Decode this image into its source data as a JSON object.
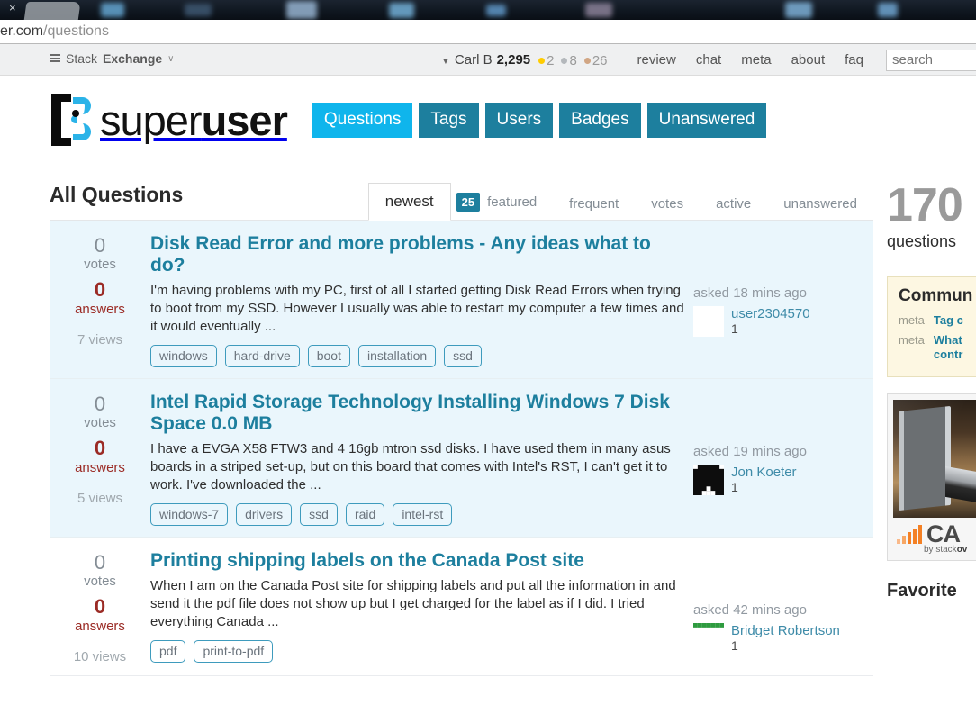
{
  "browser": {
    "tab_close_glyph": "×",
    "url_prefix": "er.com",
    "url_path": "/questions"
  },
  "topbar": {
    "network_label_light": "Stack",
    "network_label_bold": "Exchange",
    "network_caret": "∨",
    "user": {
      "caret": "▼",
      "name": "Carl B",
      "reputation": "2,295",
      "gold": "2",
      "silver": "8",
      "bronze": "26"
    },
    "links": [
      "review",
      "chat",
      "meta",
      "about",
      "faq"
    ],
    "search_placeholder": "search",
    "search_value": ""
  },
  "site": {
    "logo_light": "super",
    "logo_bold": "user",
    "nav": [
      {
        "label": "Questions",
        "active": true
      },
      {
        "label": "Tags",
        "active": false
      },
      {
        "label": "Users",
        "active": false
      },
      {
        "label": "Badges",
        "active": false
      },
      {
        "label": "Unanswered",
        "active": false
      }
    ]
  },
  "main": {
    "page_title": "All Questions",
    "tabs": {
      "newest": "newest",
      "featured_count": "25",
      "featured": "featured",
      "frequent": "frequent",
      "votes": "votes",
      "active": "active",
      "unanswered": "unanswered"
    },
    "questions": [
      {
        "votes": "0",
        "votes_label": "votes",
        "answers": "0",
        "answers_label": "answers",
        "views": "7 views",
        "title": "Disk Read Error and more problems - Any ideas what to do?",
        "excerpt": "I'm having problems with my PC, first of all I started getting Disk Read Errors when trying to boot from my SSD. However I usually was able to restart my computer a few times and it would eventually ...",
        "tags": [
          "windows",
          "hard-drive",
          "boot",
          "installation",
          "ssd"
        ],
        "asked": "asked 18 mins ago",
        "user": "user2304570",
        "user_rep": "1",
        "avatar_style": "purple"
      },
      {
        "votes": "0",
        "votes_label": "votes",
        "answers": "0",
        "answers_label": "answers",
        "views": "5 views",
        "title": "Intel Rapid Storage Technology Installing Windows 7 Disk Space 0.0 MB",
        "excerpt": "I have a EVGA X58 FTW3 and 4 16gb mtron ssd disks. I have used them in many asus boards in a striped set-up, but on this board that comes with Intel's RST, I can't get it to work. I've downloaded the ...",
        "tags": [
          "windows-7",
          "drivers",
          "ssd",
          "raid",
          "intel-rst"
        ],
        "asked": "asked 19 mins ago",
        "user": "Jon Koeter",
        "user_rep": "1",
        "avatar_style": "black"
      },
      {
        "votes": "0",
        "votes_label": "votes",
        "answers": "0",
        "answers_label": "answers",
        "views": "10 views",
        "title": "Printing shipping labels on the Canada Post site",
        "excerpt": "When I am on the Canada Post site for shipping labels and put all the information in and send it the pdf file does not show up but I get charged for the label as if I did. I tried everything Canada ...",
        "tags": [
          "pdf",
          "print-to-pdf"
        ],
        "asked": "asked 42 mins ago",
        "user": "Bridget Robertson",
        "user_rep": "1",
        "avatar_style": "green"
      }
    ]
  },
  "sidebar": {
    "question_count": "170",
    "question_count_label": "questions",
    "bulletin_title": "Commun",
    "bulletin_items": [
      {
        "meta": "meta",
        "link": "Tag c"
      },
      {
        "meta": "meta",
        "link": "What",
        "link2": "contr"
      }
    ],
    "ad": {
      "title": "CA",
      "sub_light": "by stack",
      "sub_bold": "ov"
    },
    "favorites_title": "Favorite "
  },
  "colors": {
    "accent": "#1d7f9e",
    "accent_active": "#0fb5ec",
    "row_highlight": "#eaf6fc",
    "answers_red": "#9b2b25",
    "gold": "#ffcc01",
    "silver": "#b4b8bc",
    "bronze": "#d1a684"
  }
}
